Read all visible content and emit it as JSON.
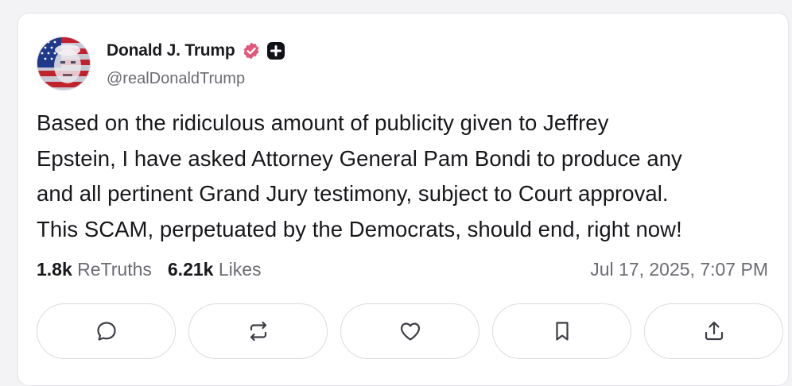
{
  "author": {
    "display_name": "Donald J. Trump",
    "handle": "@realDonaldTrump"
  },
  "post": {
    "lines": [
      "Based on the ridiculous amount of publicity given to Jeffrey",
      "Epstein, I have asked Attorney General Pam Bondi to produce any",
      "and all pertinent Grand Jury testimony, subject to Court approval.",
      "This SCAM, perpetuated by the Democrats, should end, right now!"
    ]
  },
  "stats": {
    "retruths_count": "1.8k",
    "retruths_label": "ReTruths",
    "likes_count": "6.21k",
    "likes_label": "Likes"
  },
  "timestamp": "Jul 17, 2025, 7:07 PM",
  "actions": [
    {
      "name": "reply",
      "icon": "chat-bubble-icon"
    },
    {
      "name": "retruth",
      "icon": "repost-icon"
    },
    {
      "name": "like",
      "icon": "heart-icon"
    },
    {
      "name": "bookmark",
      "icon": "bookmark-icon"
    },
    {
      "name": "share",
      "icon": "share-icon"
    }
  ],
  "colors": {
    "verified_badge": "#e3577a",
    "text_primary": "#18181c",
    "text_secondary": "#6b6b73",
    "icon": "#3c3c44"
  }
}
